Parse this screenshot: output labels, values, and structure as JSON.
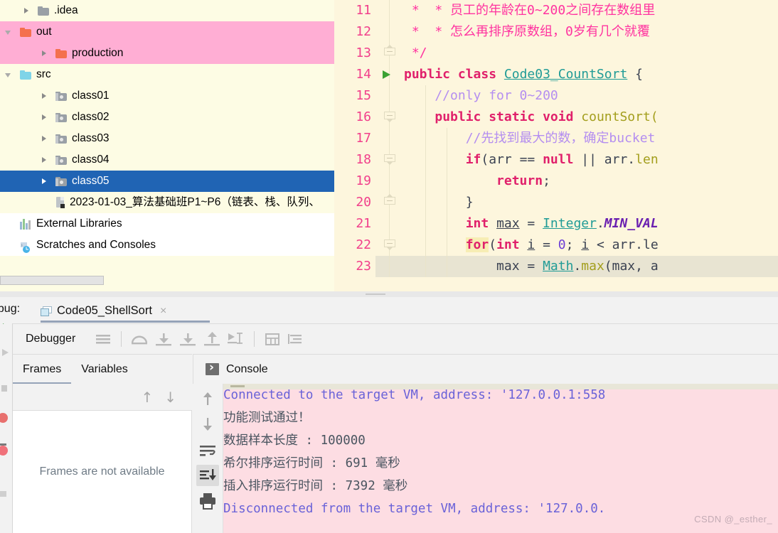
{
  "project_tree": {
    "items": [
      {
        "label": ".idea",
        "icon": "folder-icon-grey",
        "arrow": "chevron-right-icon",
        "indent": 1,
        "state": "normal"
      },
      {
        "label": "out",
        "icon": "folder-icon-orange",
        "arrow": "chevron-down-icon",
        "indent": 0,
        "state": "highlight-pink"
      },
      {
        "label": "production",
        "icon": "folder-icon-orange",
        "arrow": "chevron-right-icon",
        "indent": 2,
        "state": "highlight-pink"
      },
      {
        "label": "src",
        "icon": "folder-icon-blue",
        "arrow": "chevron-down-icon",
        "indent": 0,
        "state": "normal"
      },
      {
        "label": "class01",
        "icon": "package-icon",
        "arrow": "chevron-right-icon",
        "indent": 2,
        "state": "normal"
      },
      {
        "label": "class02",
        "icon": "package-icon",
        "arrow": "chevron-right-icon",
        "indent": 2,
        "state": "normal"
      },
      {
        "label": "class03",
        "icon": "package-icon",
        "arrow": "chevron-right-icon",
        "indent": 2,
        "state": "normal"
      },
      {
        "label": "class04",
        "icon": "package-icon",
        "arrow": "chevron-right-icon",
        "indent": 2,
        "state": "normal"
      },
      {
        "label": "class05",
        "icon": "package-icon",
        "arrow": "chevron-right-icon",
        "indent": 2,
        "state": "selected-blue"
      },
      {
        "label": "2023-01-03_算法基础班P1~P6（链表、栈、队列、",
        "icon": "file-icon",
        "arrow": "none",
        "indent": 2,
        "state": "normal"
      },
      {
        "label": "External Libraries",
        "icon": "libraries-icon",
        "arrow": "none",
        "indent": 0,
        "state": "white"
      },
      {
        "label": "Scratches and Consoles",
        "icon": "scratches-icon",
        "arrow": "none",
        "indent": 0,
        "state": "white"
      }
    ]
  },
  "editor": {
    "lines": [
      {
        "number": "11",
        "fold": "none",
        "run_marker": false,
        "indent_guides": 0,
        "tokens": [
          {
            "t": " *  * 员工的年龄在0~200之间存在数组里",
            "c": "cmt-doc"
          }
        ]
      },
      {
        "number": "12",
        "fold": "none",
        "run_marker": false,
        "indent_guides": 0,
        "tokens": [
          {
            "t": " *  * 怎么再排序原数组，0岁有几个就覆",
            "c": "cmt-doc"
          }
        ]
      },
      {
        "number": "13",
        "fold": "up",
        "run_marker": false,
        "indent_guides": 0,
        "tokens": [
          {
            "t": " */",
            "c": "cmt-doc"
          }
        ]
      },
      {
        "number": "14",
        "fold": "none",
        "run_marker": true,
        "indent_guides": 0,
        "tokens": [
          {
            "t": "public class ",
            "c": "kw"
          },
          {
            "t": "Code03_CountSort",
            "c": "cls"
          },
          {
            "t": " {",
            "c": "punc"
          }
        ]
      },
      {
        "number": "15",
        "fold": "none",
        "run_marker": false,
        "indent_guides": 1,
        "tokens": [
          {
            "t": "    //only for 0~200",
            "c": "cmt"
          }
        ]
      },
      {
        "number": "16",
        "fold": "down",
        "run_marker": false,
        "indent_guides": 1,
        "tokens": [
          {
            "t": "    ",
            "c": "punc"
          },
          {
            "t": "public static void ",
            "c": "kw"
          },
          {
            "t": "countSort(",
            "c": "fn"
          }
        ]
      },
      {
        "number": "17",
        "fold": "none",
        "run_marker": false,
        "indent_guides": 2,
        "tokens": [
          {
            "t": "        //先找到最大的数，确定bucket",
            "c": "cmt"
          }
        ]
      },
      {
        "number": "18",
        "fold": "down",
        "run_marker": false,
        "indent_guides": 2,
        "tokens": [
          {
            "t": "        ",
            "c": "punc"
          },
          {
            "t": "if",
            "c": "kw"
          },
          {
            "t": "(arr == ",
            "c": "ident"
          },
          {
            "t": "null",
            "c": "kw"
          },
          {
            "t": " || arr.",
            "c": "ident"
          },
          {
            "t": "len",
            "c": "fld"
          }
        ]
      },
      {
        "number": "19",
        "fold": "none",
        "run_marker": false,
        "indent_guides": 2,
        "tokens": [
          {
            "t": "            ",
            "c": "punc"
          },
          {
            "t": "return",
            "c": "kw"
          },
          {
            "t": ";",
            "c": "punc"
          }
        ]
      },
      {
        "number": "20",
        "fold": "up",
        "run_marker": false,
        "indent_guides": 2,
        "tokens": [
          {
            "t": "        }",
            "c": "punc"
          }
        ]
      },
      {
        "number": "21",
        "fold": "none",
        "run_marker": false,
        "indent_guides": 2,
        "tokens": [
          {
            "t": "        ",
            "c": "punc"
          },
          {
            "t": "int ",
            "c": "kw"
          },
          {
            "t": "max",
            "c": "ident-u"
          },
          {
            "t": " = ",
            "c": "ident"
          },
          {
            "t": "Integer",
            "c": "cls"
          },
          {
            "t": ".",
            "c": "ident"
          },
          {
            "t": "MIN_VAL",
            "c": "const"
          }
        ]
      },
      {
        "number": "22",
        "fold": "down",
        "run_marker": false,
        "indent_guides": 2,
        "tokens": [
          {
            "t": "        ",
            "c": "punc"
          },
          {
            "t": "for",
            "c": "kw hl-for"
          },
          {
            "t": "(",
            "c": "ident"
          },
          {
            "t": "int ",
            "c": "kw"
          },
          {
            "t": "i",
            "c": "ident-u"
          },
          {
            "t": " = ",
            "c": "ident"
          },
          {
            "t": "0",
            "c": "num"
          },
          {
            "t": "; ",
            "c": "ident"
          },
          {
            "t": "i",
            "c": "ident-u"
          },
          {
            "t": " < arr.",
            "c": "ident"
          },
          {
            "t": "le",
            "c": "ident"
          }
        ]
      },
      {
        "number": "23",
        "fold": "none",
        "run_marker": false,
        "indent_guides": 2,
        "selected": true,
        "tokens": [
          {
            "t": "            max = ",
            "c": "ident"
          },
          {
            "t": "Math",
            "c": "cls"
          },
          {
            "t": ".",
            "c": "ident"
          },
          {
            "t": "max",
            "c": "fn"
          },
          {
            "t": "(max, a",
            "c": "ident"
          }
        ]
      }
    ]
  },
  "debug": {
    "window_label": "ebug:",
    "tab": {
      "title": "Code05_ShellSort",
      "close": "×",
      "icon": "debug-config-icon"
    },
    "toolbar": {
      "label": "Debugger",
      "buttons": [
        "menu-icon",
        "step-over-icon",
        "step-into-icon",
        "force-step-into-icon",
        "step-out-icon",
        "run-to-cursor-icon",
        "evaluate-table-icon",
        "sort-values-icon"
      ]
    },
    "tabs": [
      {
        "label": "Frames",
        "active": true
      },
      {
        "label": "Variables",
        "active": false
      }
    ],
    "console_tab_label": "Console",
    "frames_empty_text": "Frames are not available",
    "frames_nav": [
      "arrow-up-icon",
      "arrow-down-icon"
    ],
    "console_side_buttons": [
      "scroll-up-icon",
      "scroll-down-icon",
      "soft-wrap-icon",
      "scroll-to-end-icon",
      "print-icon"
    ],
    "console_lines": [
      {
        "text": "Connected to the target VM, address: '127.0.0.1:558",
        "kind": "system"
      },
      {
        "text": "功能测试通过！",
        "kind": "output"
      },
      {
        "text": "数据样本长度 : 100000",
        "kind": "output"
      },
      {
        "text": "希尔排序运行时间 : 691 毫秒",
        "kind": "output"
      },
      {
        "text": "插入排序运行时间 : 7392 毫秒",
        "kind": "output"
      },
      {
        "text": "Disconnected from the target VM, address: '127.0.0.",
        "kind": "system"
      }
    ],
    "watermark": "CSDN @_esther_"
  },
  "colors": {
    "tree_background": "#fdfce4",
    "tree_highlight_pink": "#ffaed4",
    "tree_selection_blue": "#2064b4",
    "editor_background": "#fdf6dd",
    "line_number": "#f13f8b",
    "keyword": "#e0206b",
    "class_name": "#1f9b96",
    "comment": "#b48ef0",
    "doc_comment": "#ff33a0",
    "console_background": "#fddde3",
    "console_system_text": "#6a62d8",
    "console_output_text": "#4a5560",
    "panel_background": "#f2f2f2"
  }
}
